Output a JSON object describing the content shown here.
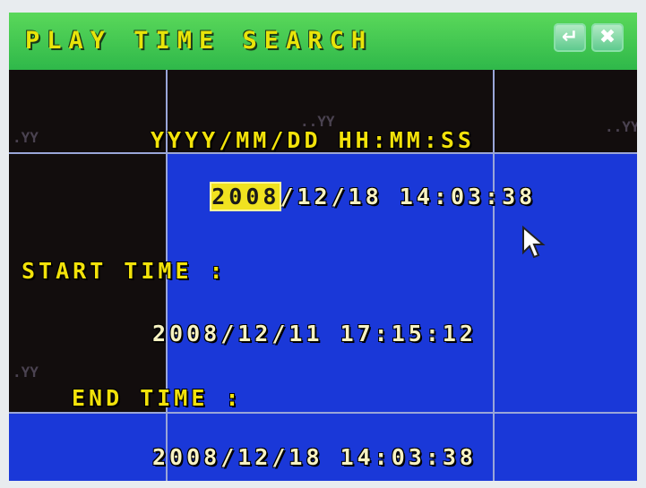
{
  "window": {
    "title": "PLAY TIME SEARCH",
    "back_icon": "↵",
    "close_icon": "✖"
  },
  "format_header": "YYYY/MM/DD HH:MM:SS",
  "current": {
    "year": "2008",
    "rest": "/12/18 14:03:38"
  },
  "start": {
    "label": "START TIME :",
    "value": "2008/12/11 17:15:12"
  },
  "end": {
    "label": "END TIME :",
    "value": "2008/12/18 14:03:38"
  },
  "faint_overlays": [
    ".YY",
    "..YY",
    "..YY",
    ".YY"
  ],
  "colors": {
    "screen_bg": "#1a38d8",
    "title_bar": "#3fc05a",
    "title_text": "#e8e40a",
    "selection": "#f0e220"
  }
}
